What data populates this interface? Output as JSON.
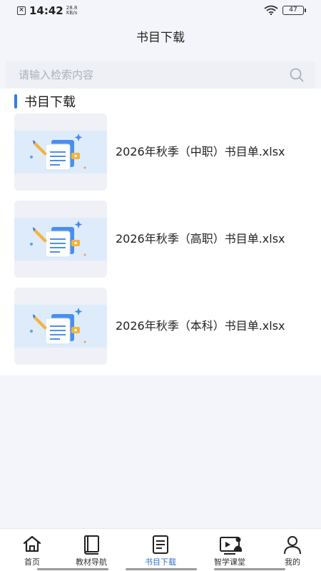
{
  "status_bar": {
    "time": "14:42",
    "speed_value": "28.8",
    "speed_unit": "KB/s",
    "battery": "47",
    "icons": [
      "close-box-icon",
      "wifi-icon",
      "battery-icon"
    ]
  },
  "header": {
    "title": "书目下载"
  },
  "search": {
    "placeholder": "请输入检索内容",
    "icon": "search-icon"
  },
  "section": {
    "title": "书目下载"
  },
  "files": [
    {
      "name": "2026年秋季（中职）书目单.xlsx",
      "icon": "document-pencil-icon"
    },
    {
      "name": "2026年秋季（高职）书目单.xlsx",
      "icon": "document-pencil-icon"
    },
    {
      "name": "2026年秋季（本科）书目单.xlsx",
      "icon": "document-pencil-icon"
    }
  ],
  "tabbar": {
    "active": "tab-booklist",
    "items": [
      {
        "label": "首页",
        "icon": "home-icon"
      },
      {
        "label": "教材导航",
        "icon": "book-icon"
      },
      {
        "label": "书目下载",
        "icon": "list-document-icon"
      },
      {
        "label": "智学课堂",
        "icon": "classroom-icon"
      },
      {
        "label": "我的",
        "icon": "user-icon"
      }
    ]
  },
  "colors": {
    "accent": "#2f7fe0",
    "active_tab": "#2f6fd6",
    "background": "#f4f5fa"
  }
}
